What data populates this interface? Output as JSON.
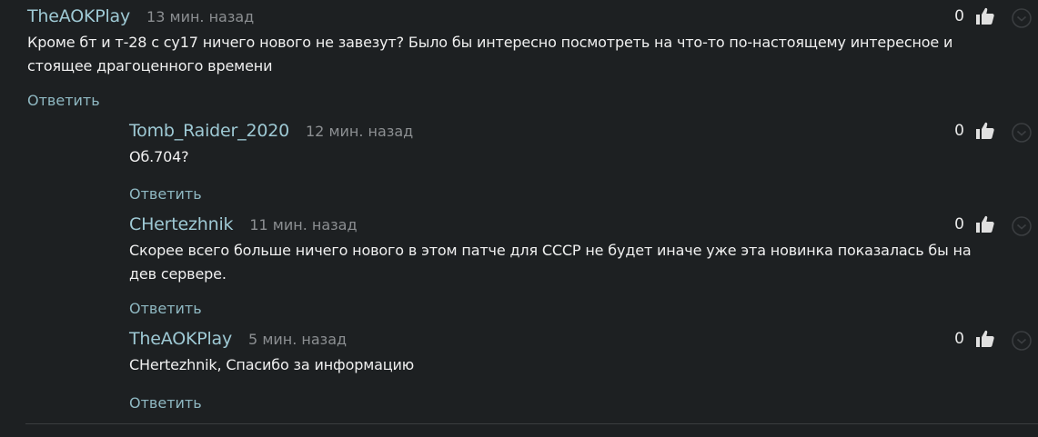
{
  "reply_label": "Ответить",
  "comments": [
    {
      "author": "TheAOKPlay",
      "time": "13 мин. назад",
      "text": "Кроме бт и т-28 с су17 ничего нового не завезут? Было бы интересно посмотреть на что-то по-настоящему интересное и стоящее драгоценного времени",
      "likes": "0",
      "icon": "thumbs-up-icon"
    },
    {
      "author": "Tomb_Raider_2020",
      "time": "12 мин. назад",
      "text": "Об.704?",
      "likes": "0",
      "icon": "thumbs-up-icon"
    },
    {
      "author": "CHertezhnik",
      "time": "11 мин. назад",
      "text": "Скорее всего больше ничего нового в этом патче для СССР не будет иначе уже эта новинка показалась бы на дев сервере.",
      "likes": "0",
      "icon": "thumbs-up-icon"
    },
    {
      "author": "TheAOKPlay",
      "time": "5 мин. назад",
      "text": "CHertezhnik, Спасибо за информацию",
      "likes": "0",
      "icon": "thumbs-up-icon"
    }
  ],
  "colors": {
    "background": "#1d2022",
    "author": "#9ec9d4",
    "reply": "#8fb8c2",
    "time": "#8c8f92",
    "text": "#f0f0f0"
  }
}
